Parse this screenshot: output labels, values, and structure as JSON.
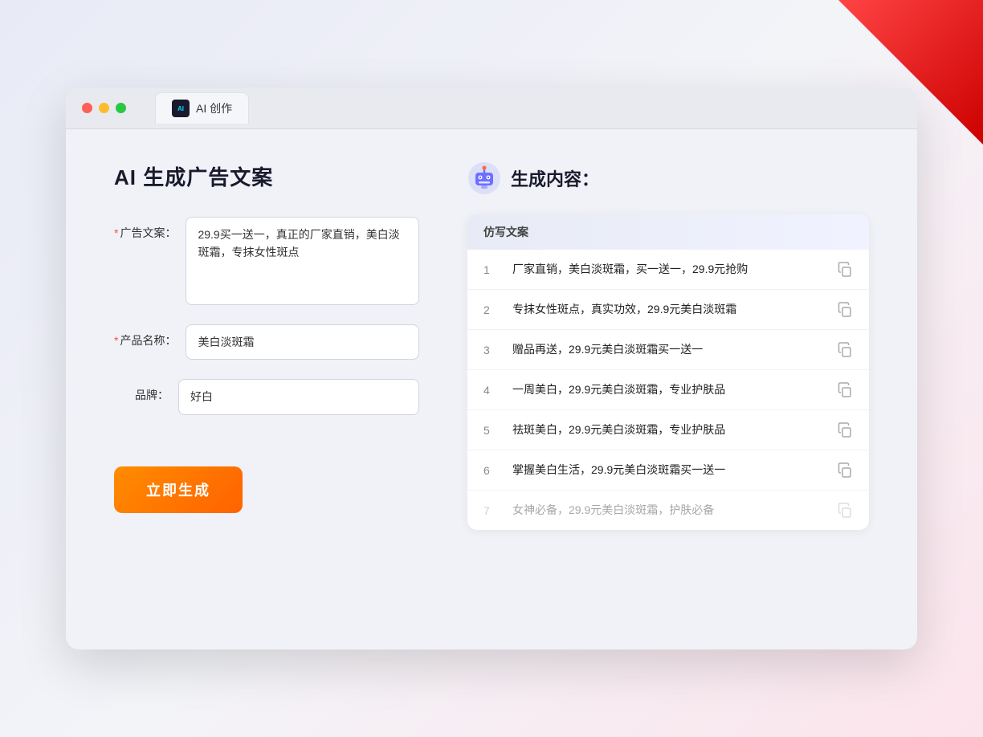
{
  "browser": {
    "tab_label": "AI 创作"
  },
  "page": {
    "title": "AI 生成广告文案"
  },
  "form": {
    "ad_copy_label": "广告文案：",
    "ad_copy_required": "*",
    "ad_copy_value": "29.9买一送一，真正的厂家直销，美白淡斑霜，专抹女性斑点",
    "product_name_label": "产品名称：",
    "product_name_required": "*",
    "product_name_value": "美白淡斑霜",
    "brand_label": "品牌：",
    "brand_value": "好白",
    "generate_button": "立即生成"
  },
  "results": {
    "section_title": "生成内容：",
    "column_header": "仿写文案",
    "items": [
      {
        "num": "1",
        "text": "厂家直销，美白淡斑霜，买一送一，29.9元抢购",
        "dimmed": false
      },
      {
        "num": "2",
        "text": "专抹女性斑点，真实功效，29.9元美白淡斑霜",
        "dimmed": false
      },
      {
        "num": "3",
        "text": "赠品再送，29.9元美白淡斑霜买一送一",
        "dimmed": false
      },
      {
        "num": "4",
        "text": "一周美白，29.9元美白淡斑霜，专业护肤品",
        "dimmed": false
      },
      {
        "num": "5",
        "text": "祛斑美白，29.9元美白淡斑霜，专业护肤品",
        "dimmed": false
      },
      {
        "num": "6",
        "text": "掌握美白生活，29.9元美白淡斑霜买一送一",
        "dimmed": false
      },
      {
        "num": "7",
        "text": "女神必备，29.9元美白淡斑霜，护肤必备",
        "dimmed": true
      }
    ]
  }
}
